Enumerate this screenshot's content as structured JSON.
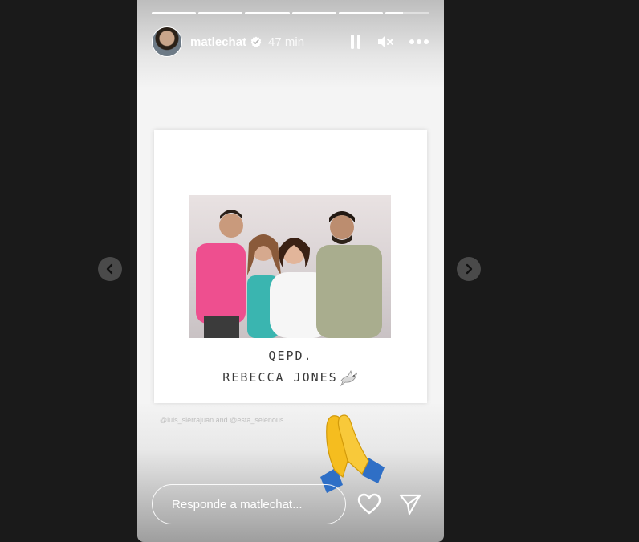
{
  "story": {
    "progress": [
      1,
      1,
      1,
      1,
      1,
      0.4
    ],
    "user": {
      "username": "matlechat",
      "time": "47 min"
    },
    "card": {
      "caption_line1": "QEPD.",
      "caption_line2": "REBECCA JONES"
    },
    "mentions": "@luis_sierrajuan and @esta_selenous",
    "reply_placeholder": "Responde a matlechat...",
    "colors": {
      "background": "#1a1a1a",
      "accent": "#ffffff",
      "nav_button": "#4a4a4a"
    },
    "icons": [
      "verified-badge-icon",
      "pause-icon",
      "mute-icon",
      "more-options-icon",
      "heart-icon",
      "send-icon",
      "chevron-left-icon",
      "chevron-right-icon",
      "dove-icon",
      "folded-hands-emoji"
    ]
  }
}
